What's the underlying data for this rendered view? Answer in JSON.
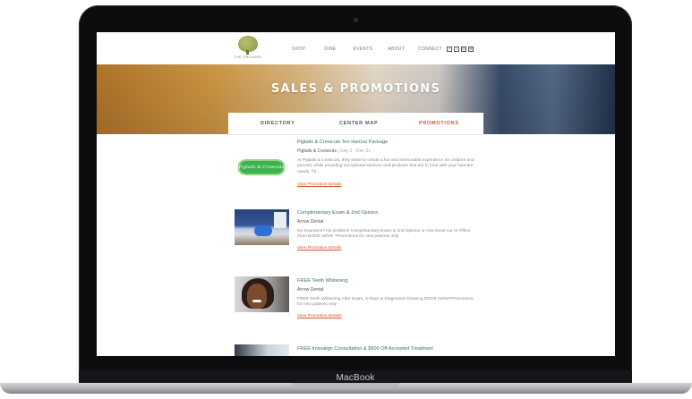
{
  "device": {
    "label": "MacBook"
  },
  "site": {
    "logo_text": "THE ORCHARD",
    "nav": [
      "SHOP",
      "DINE",
      "EVENTS",
      "ABOUT",
      "CONNECT"
    ],
    "social": [
      "facebook-icon",
      "twitter-icon",
      "instagram-icon",
      "email-icon"
    ]
  },
  "hero": {
    "title": "SALES & PROMOTIONS"
  },
  "tabs": [
    "DIRECTORY",
    "CENTER MAP",
    "PROMOTIONS"
  ],
  "active_tab": "PROMOTIONS",
  "colors": {
    "accent": "#d6552d",
    "title": "#456c5f"
  },
  "promotions": [
    {
      "title": "Pigtails & Crewcuts Ten Haircut Package",
      "store": "Pigtails & Crewcuts",
      "date": "| Sep 3 - Dec 31",
      "description": "At Pigtails & Crewcuts, they strive to create a fun and memorable experience for children and parents, while providing exceptional services and products that are in tune with your haircare needs.  Th...",
      "link": "View Promotion Details",
      "thumb_text": "Pigtails & Crewcuts"
    },
    {
      "title": "Complimentary Exam & 2nd Opinion",
      "store": "Arrow Dental",
      "date": "",
      "description": "No insurance? No problem! Complimentary Exam & 2nd Opinion or Ask About our In-Office Plan! BOOK NOW! *Promotions for new patients only",
      "link": "View Promotion Details"
    },
    {
      "title": "FREE Teeth Whitening",
      "store": "Arrow Dental",
      "date": "",
      "description": "FREE Teeth Whitening After Exam, X-Rays & Diagnosed Cleaning BOOK NOW!*Promotions for new patients only",
      "link": "View Promotion Details"
    },
    {
      "title": "FREE Invisalign Consultation & $500 Off Accepted Treatment"
    }
  ]
}
